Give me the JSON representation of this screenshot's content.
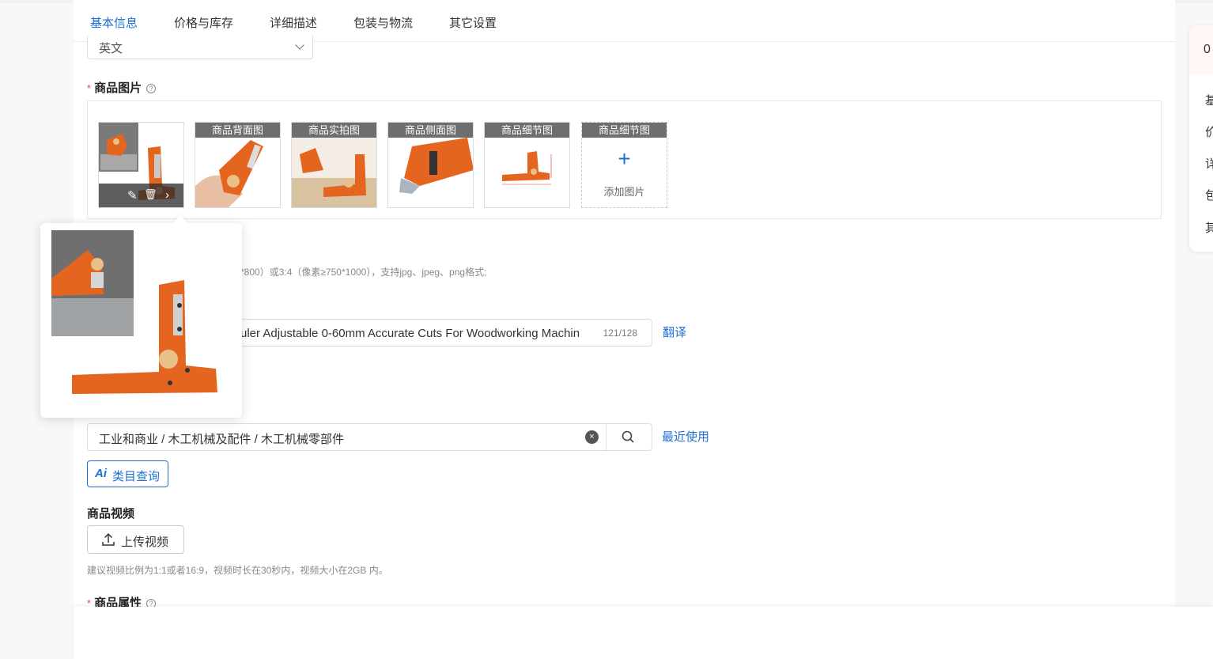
{
  "tabs": [
    {
      "label": "基本信息",
      "active": true
    },
    {
      "label": "价格与库存",
      "active": false
    },
    {
      "label": "详细描述",
      "active": false
    },
    {
      "label": "包装与物流",
      "active": false
    },
    {
      "label": "其它设置",
      "active": false
    }
  ],
  "language": {
    "value": "英文"
  },
  "images": {
    "label": "商品图片",
    "required_mark": "*",
    "help": "?",
    "thumb_captions": [
      "商品背面图",
      "商品实拍图",
      "商品侧面图",
      "商品细节图"
    ],
    "add": {
      "caption": "商品细节图",
      "plus": "+",
      "label": "添加图片"
    },
    "tools": {
      "edit": "✎",
      "delete": "🗑",
      "next": "›"
    },
    "hint": "*800）或3:4（像素≥750*1000），支持jpg、jpeg、png格式;"
  },
  "title": {
    "value": "uler Adjustable 0-60mm Accurate Cuts For Woodworking Machin",
    "count": "121/128",
    "translate": "翻译"
  },
  "category": {
    "value": "工业和商业 / 木工机械及配件 / 木工机械零部件",
    "clear": "×",
    "recent": "最近使用",
    "ai_icon": "Ai",
    "ai_button": "类目查询"
  },
  "video": {
    "label": "商品视频",
    "upload_button": "上传视频",
    "hint": "建议视频比例为1:1或者16:9，视频时长在30秒内，视频大小在2GB 内。"
  },
  "attributes": {
    "label": "商品属性",
    "required_mark": "*",
    "help": "?"
  },
  "right_panel": {
    "count": "0",
    "items": [
      "基",
      "价",
      "详",
      "包",
      "其"
    ]
  },
  "colors": {
    "accent": "#1f6fd6",
    "product_orange": "#e4651f",
    "required": "#e5484d"
  }
}
